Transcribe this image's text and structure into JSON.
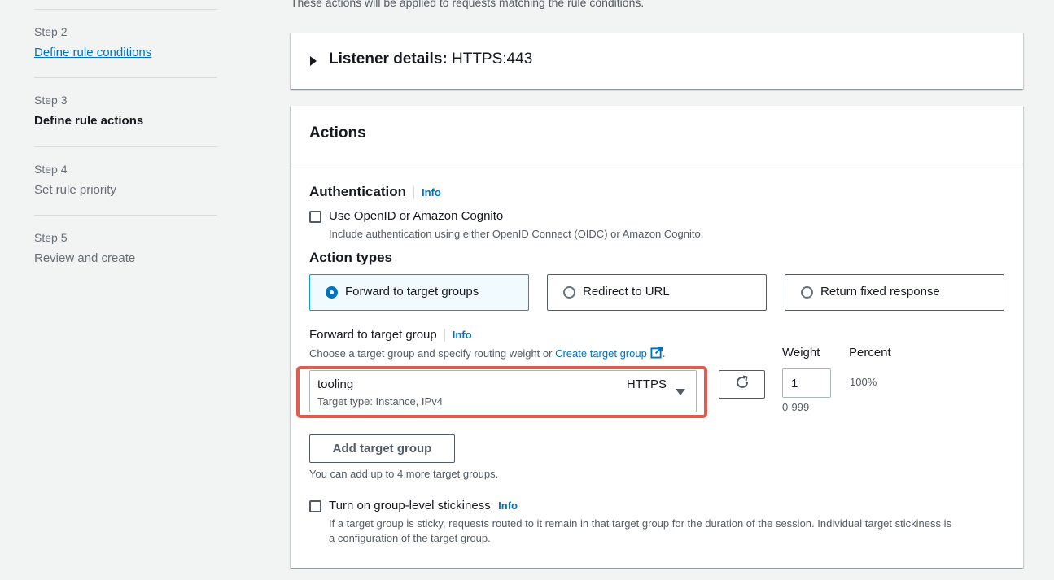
{
  "top_note": "These actions will be applied to requests matching the rule conditions.",
  "steps": [
    {
      "number": "Step 2",
      "title": "Define rule conditions"
    },
    {
      "number": "Step 3",
      "title": "Define rule actions"
    },
    {
      "number": "Step 4",
      "title": "Set rule priority"
    },
    {
      "number": "Step 5",
      "title": "Review and create"
    }
  ],
  "listener": {
    "label": "Listener details:",
    "value": "HTTPS:443"
  },
  "actions": {
    "title": "Actions",
    "authentication": {
      "label": "Authentication",
      "info": "Info",
      "checkbox_label": "Use OpenID or Amazon Cognito",
      "description": "Include authentication using either OpenID Connect (OIDC) or Amazon Cognito."
    },
    "action_types": {
      "label": "Action types",
      "options": [
        "Forward to target groups",
        "Redirect to URL",
        "Return fixed response"
      ],
      "selected": "Forward to target groups"
    },
    "forward": {
      "label": "Forward to target group",
      "info": "Info",
      "description_prefix": "Choose a target group and specify routing weight or ",
      "create_link": "Create target group",
      "description_suffix": ".",
      "weight_label": "Weight",
      "percent_label": "Percent",
      "target_group": "tooling",
      "protocol": "HTTPS",
      "target_type": "Target type: Instance, IPv4",
      "weight_value": "1",
      "weight_hint": "0-999",
      "percent_value": "100%"
    },
    "add_target_group": {
      "label": "Add target group",
      "hint": "You can add up to 4 more target groups."
    },
    "stickiness": {
      "label": "Turn on group-level stickiness",
      "info": "Info",
      "description_line1": "If a target group is sticky, requests routed to it remain in that target group for the duration of the session. Individual target stickiness is",
      "description_line2": "a configuration of the target group."
    }
  },
  "colors": {
    "accent": "#0073bb",
    "highlight": "#e05b50",
    "selected_tile_bg": "#f1faff"
  }
}
